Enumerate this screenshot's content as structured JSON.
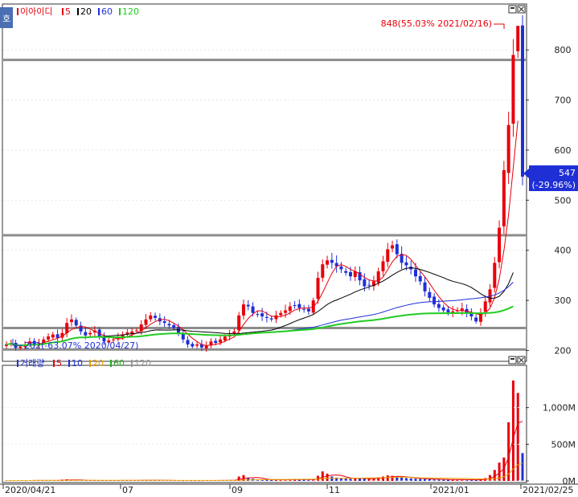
{
  "side_tab": "호",
  "price_panel": {
    "legend": [
      {
        "label": "이아이디",
        "color": "#e8000b"
      },
      {
        "label": "5",
        "color": "#e8000b"
      },
      {
        "label": "20",
        "color": "#000000"
      },
      {
        "label": "60",
        "color": "#1f2fd6"
      },
      {
        "label": "120",
        "color": "#22cc22"
      }
    ],
    "yticks": [
      "800",
      "700",
      "600",
      "500",
      "400",
      "300",
      "200"
    ],
    "high_annotation": "848(55.03% 2021/02/16)",
    "low_annotation": "202(-63.07% 2020/04/27)",
    "current_price": "547",
    "current_change": "(-29.96%)"
  },
  "volume_panel": {
    "legend": [
      {
        "label": "거래량",
        "color": "#1f2fd6"
      },
      {
        "label": "5",
        "color": "#e8000b"
      },
      {
        "label": "10",
        "color": "#1f2fd6"
      },
      {
        "label": "20",
        "color": "#e8a000"
      },
      {
        "label": "60",
        "color": "#22aa22"
      },
      {
        "label": "120",
        "color": "#999999"
      }
    ],
    "yticks": [
      "1,000M",
      "500M",
      "0M"
    ]
  },
  "xaxis": {
    "labels": [
      "2020/04/21",
      "07",
      "09",
      "11",
      "2021/01",
      "2021/02/25"
    ]
  },
  "chart_data": {
    "type": "candlestick",
    "price_range": [
      180,
      890
    ],
    "horizontal_levels": [
      780,
      430,
      245,
      202
    ],
    "high": {
      "value": 848,
      "date": "2021/02/16",
      "change_pct": 55.03
    },
    "low": {
      "value": 202,
      "date": "2020/04/27",
      "change_pct": -63.07
    },
    "last": {
      "value": 547,
      "change_pct": -29.96
    },
    "close_path": [
      212,
      215,
      205,
      208,
      212,
      218,
      210,
      215,
      222,
      228,
      232,
      225,
      235,
      255,
      262,
      250,
      238,
      230,
      235,
      240,
      226,
      218,
      220,
      222,
      228,
      232,
      236,
      238,
      240,
      252,
      262,
      270,
      265,
      258,
      255,
      250,
      245,
      235,
      222,
      212,
      208,
      212,
      206,
      210,
      218,
      215,
      222,
      228,
      232,
      238,
      270,
      292,
      288,
      275,
      272,
      268,
      265,
      262,
      270,
      275,
      280,
      288,
      290,
      285,
      282,
      278,
      300,
      345,
      372,
      380,
      375,
      368,
      362,
      355,
      348,
      358,
      340,
      328,
      330,
      338,
      358,
      378,
      402,
      410,
      392,
      375,
      370,
      362,
      348,
      338,
      318,
      305,
      292,
      285,
      280,
      276,
      278,
      280,
      284,
      274,
      268,
      258,
      275,
      298,
      322,
      375,
      445,
      560,
      650,
      790,
      848,
      547
    ],
    "volume_path": [
      5,
      5,
      8,
      6,
      4,
      6,
      7,
      9,
      6,
      5,
      6,
      8,
      18,
      22,
      10,
      8,
      6,
      5,
      6,
      7,
      5,
      6,
      5,
      6,
      7,
      8,
      6,
      7,
      6,
      12,
      14,
      10,
      8,
      7,
      6,
      6,
      5,
      5,
      4,
      5,
      4,
      5,
      5,
      6,
      6,
      7,
      8,
      8,
      9,
      10,
      60,
      80,
      45,
      30,
      22,
      18,
      16,
      14,
      15,
      18,
      20,
      22,
      20,
      18,
      16,
      15,
      28,
      70,
      130,
      100,
      60,
      45,
      40,
      35,
      30,
      35,
      38,
      30,
      28,
      30,
      50,
      60,
      75,
      70,
      55,
      45,
      40,
      35,
      30,
      28,
      25,
      22,
      20,
      18,
      18,
      17,
      17,
      16,
      18,
      16,
      15,
      14,
      20,
      40,
      80,
      150,
      250,
      320,
      800,
      1370,
      1200,
      380
    ],
    "volume_range": [
      0,
      1500
    ]
  }
}
